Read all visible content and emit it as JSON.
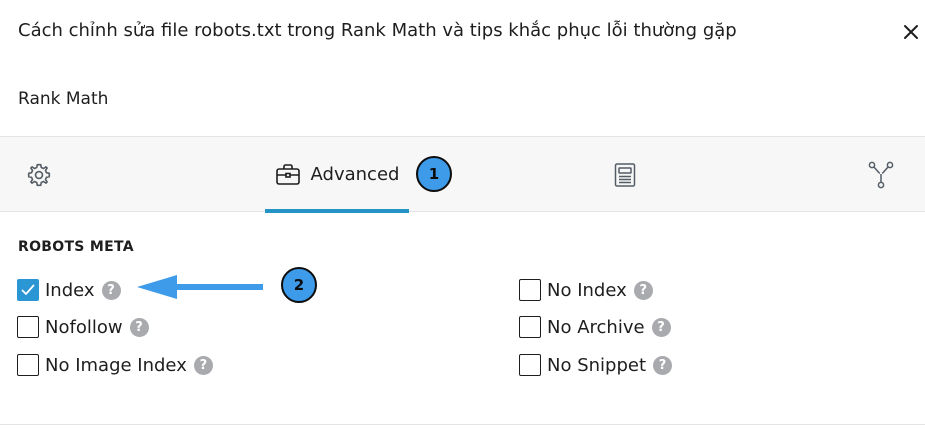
{
  "header": {
    "title": "Cách chỉnh sửa file robots.txt trong Rank Math và tips khắc phục lỗi thường gặp",
    "close_icon": "close-icon"
  },
  "panel": {
    "plugin_name": "Rank Math"
  },
  "tabs": [
    {
      "id": "general",
      "icon": "gear-icon",
      "label": ""
    },
    {
      "id": "advanced",
      "icon": "briefcase-icon",
      "label": "Advanced",
      "active": true
    },
    {
      "id": "schema",
      "icon": "document-icon",
      "label": ""
    },
    {
      "id": "social",
      "icon": "share-network-icon",
      "label": ""
    }
  ],
  "annotations": {
    "badge_1": "1",
    "badge_2": "2",
    "badge_color": "#3d9be9",
    "arrow_color": "#3d9be9"
  },
  "robots_meta": {
    "title": "ROBOTS META",
    "options": [
      {
        "label": "Index",
        "checked": true
      },
      {
        "label": "Nofollow",
        "checked": false
      },
      {
        "label": "No Image Index",
        "checked": false
      },
      {
        "label": "No Index",
        "checked": false
      },
      {
        "label": "No Archive",
        "checked": false
      },
      {
        "label": "No Snippet",
        "checked": false
      }
    ],
    "help_glyph": "?"
  },
  "colors": {
    "accent": "#2593c6",
    "checkbox_checked": "#2a96d4",
    "tab_bar_bg": "#f7f7f7",
    "help_icon_bg": "#a8aaad"
  }
}
